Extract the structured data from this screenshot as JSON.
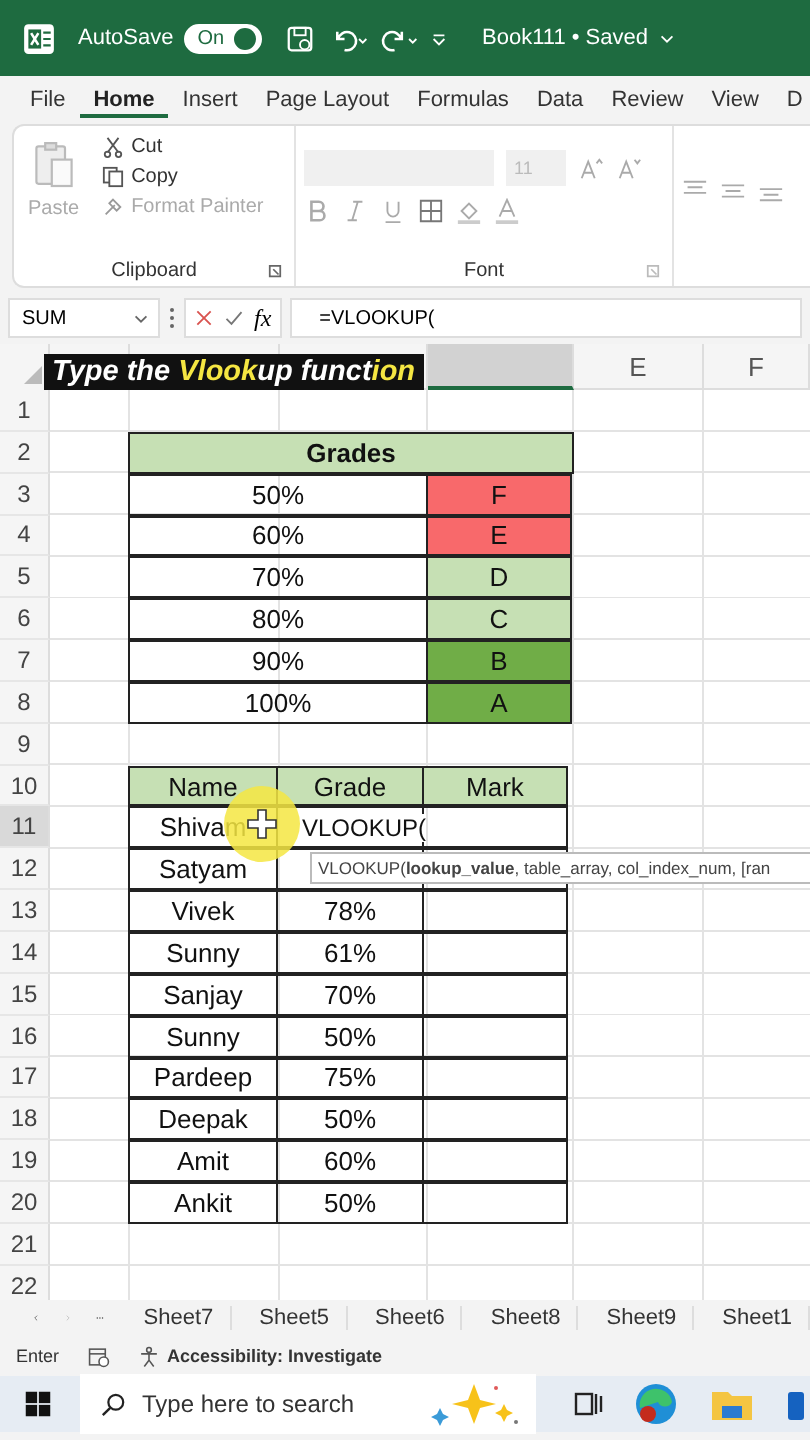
{
  "title_bar": {
    "autosave_label": "AutoSave",
    "autosave_on": true,
    "toggle_text": "On",
    "document_title": "Book111 • Saved"
  },
  "ribbon_tabs": [
    {
      "label": "File",
      "selected": false
    },
    {
      "label": "Home",
      "selected": true
    },
    {
      "label": "Insert",
      "selected": false
    },
    {
      "label": "Page Layout",
      "selected": false
    },
    {
      "label": "Formulas",
      "selected": false
    },
    {
      "label": "Data",
      "selected": false
    },
    {
      "label": "Review",
      "selected": false
    },
    {
      "label": "View",
      "selected": false
    },
    {
      "label": "D",
      "selected": false
    }
  ],
  "ribbon": {
    "paste": "Paste",
    "cut": "Cut",
    "copy": "Copy",
    "format_painter": "Format Painter",
    "clipboard_label": "Clipboard",
    "font_size": "11",
    "font_label": "Font"
  },
  "formula_bar": {
    "name_box": "SUM",
    "fx": "fx",
    "formula": "=VLOOKUP("
  },
  "caption": [
    {
      "text": "Type the ",
      "highlight": false
    },
    {
      "text": "Vlook",
      "highlight": true
    },
    {
      "text": "up funct",
      "highlight": false
    },
    {
      "text": "ion",
      "highlight": true
    }
  ],
  "column_headers": [
    {
      "selected": true
    },
    {
      "label": "E",
      "selected": false
    },
    {
      "label": "F",
      "selected": false
    }
  ],
  "row_headers": [
    {
      "label": "1",
      "selected": false
    },
    {
      "label": "2",
      "selected": false
    },
    {
      "label": "3",
      "selected": false
    },
    {
      "label": "4",
      "selected": false
    },
    {
      "label": "5",
      "selected": false
    },
    {
      "label": "6",
      "selected": false
    },
    {
      "label": "7",
      "selected": false
    },
    {
      "label": "8",
      "selected": false
    },
    {
      "label": "9",
      "selected": false
    },
    {
      "label": "10",
      "selected": false
    },
    {
      "label": "11",
      "selected": true
    },
    {
      "label": "12",
      "selected": false
    },
    {
      "label": "13",
      "selected": false
    },
    {
      "label": "14",
      "selected": false
    },
    {
      "label": "15",
      "selected": false
    },
    {
      "label": "16",
      "selected": false
    },
    {
      "label": "17",
      "selected": false
    },
    {
      "label": "18",
      "selected": false
    },
    {
      "label": "19",
      "selected": false
    },
    {
      "label": "20",
      "selected": false
    },
    {
      "label": "21",
      "selected": false
    },
    {
      "label": "22",
      "selected": false
    }
  ],
  "grades_table": {
    "title": "Grades",
    "rows": [
      {
        "percent": "50%",
        "grade": "F",
        "color": "#f8696b"
      },
      {
        "percent": "60%",
        "grade": "E",
        "color": "#f8696b"
      },
      {
        "percent": "70%",
        "grade": "D",
        "color": "#c6e0b4"
      },
      {
        "percent": "80%",
        "grade": "C",
        "color": "#c6e0b4"
      },
      {
        "percent": "90%",
        "grade": "B",
        "color": "#70ad47"
      },
      {
        "percent": "100%",
        "grade": "A",
        "color": "#70ad47"
      }
    ]
  },
  "students_table": {
    "columns": [
      "Name",
      "Grade",
      "Mark"
    ],
    "editing_value": "VLOOKUP(",
    "rows": [
      {
        "name": "Shivam"
      },
      {
        "name": "Satyam"
      },
      {
        "name": "Vivek",
        "grade": "78%"
      },
      {
        "name": "Sunny",
        "grade": "61%"
      },
      {
        "name": "Sanjay",
        "grade": "70%"
      },
      {
        "name": "Sunny",
        "grade": "50%"
      },
      {
        "name": "Pardeep",
        "grade": "75%"
      },
      {
        "name": "Deepak",
        "grade": "50%"
      },
      {
        "name": "Amit",
        "grade": "60%"
      },
      {
        "name": "Ankit",
        "grade": "50%"
      }
    ]
  },
  "tooltip": "VLOOKUP(**lookup_value**, table_array, col_index_num, [ran",
  "sheet_tabs": [
    "Sheet7",
    "Sheet5",
    "Sheet6",
    "Sheet8",
    "Sheet9",
    "Sheet1"
  ],
  "status_bar": {
    "mode": "Enter",
    "accessibility": "Accessibility: Investigate"
  },
  "taskbar": {
    "search_placeholder": "Type here to search"
  }
}
